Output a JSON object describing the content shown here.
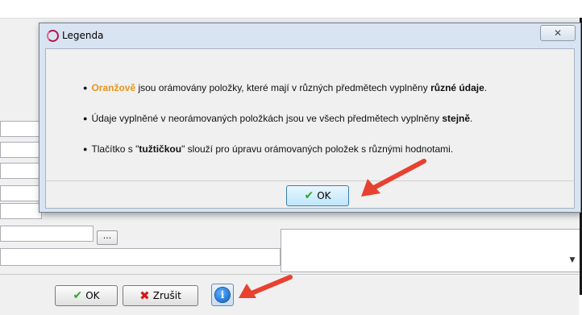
{
  "dialog": {
    "title": "Legenda",
    "close_glyph": "✕",
    "lines": [
      {
        "colored": "Oranžově",
        "rest": " jsou orámovány položky, které mají v různých předmětech vyplněny ",
        "strong": "různé údaje",
        "end": "."
      },
      {
        "rest": "Údaje vyplněné v neorámovaných položkách jsou ve všech předmětech vyplněny ",
        "strong": "stejně",
        "end": "."
      },
      {
        "pre": "Tlačítko s \"",
        "strong": "tužtičkou",
        "rest": "\" slouží pro úpravu orámovaných položek s různými hodnotami."
      }
    ],
    "ok_label": "OK"
  },
  "background": {
    "ellipsis": "...",
    "scroll_down_glyph": "▼"
  },
  "footer": {
    "ok_label": "OK",
    "cancel_label": "Zrušit",
    "info_glyph": "i"
  },
  "icons": {
    "check": "✔",
    "cross": "✖",
    "bullet": "●"
  },
  "colors": {
    "highlight_orange": "#e8941a",
    "annotation_arrow": "#e8412f"
  }
}
